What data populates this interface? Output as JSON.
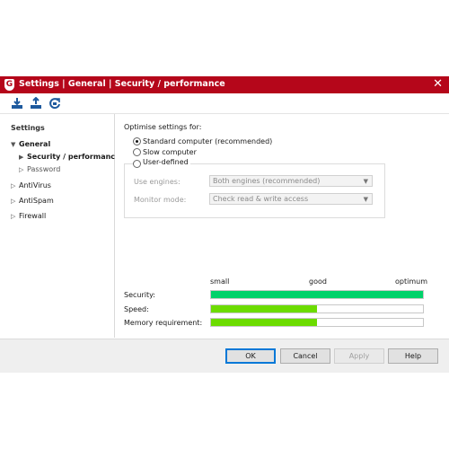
{
  "window": {
    "title": "Settings | General | Security / performance",
    "logo_letter": "G",
    "close_glyph": "✕",
    "accent_color": "#b5061a"
  },
  "toolbar": {
    "icons": [
      "import-icon",
      "export-icon",
      "restore-defaults-icon"
    ]
  },
  "sidebar": {
    "heading": "Settings",
    "items": [
      {
        "label": "General",
        "expanded": true
      },
      {
        "label": "Security / performance",
        "selected": true
      },
      {
        "label": "Password"
      },
      {
        "label": "AntiVirus"
      },
      {
        "label": "AntiSpam"
      },
      {
        "label": "Firewall"
      }
    ]
  },
  "main": {
    "optimise_label": "Optimise settings for:",
    "options": [
      {
        "label": "Standard computer (recommended)",
        "checked": true
      },
      {
        "label": "Slow computer",
        "checked": false
      },
      {
        "label": "User-defined",
        "checked": false
      }
    ],
    "use_engines_label": "Use engines:",
    "use_engines_value": "Both engines (recommended)",
    "monitor_mode_label": "Monitor mode:",
    "monitor_mode_value": "Check read & write access",
    "scale": {
      "low": "small",
      "mid": "good",
      "high": "optimum"
    },
    "meters": [
      {
        "label": "Security:",
        "fraction": 1.0,
        "color": "#00d26a"
      },
      {
        "label": "Speed:",
        "fraction": 0.5,
        "color": "#6cdc00"
      },
      {
        "label": "Memory requirement:",
        "fraction": 0.5,
        "color": "#6cdc00"
      }
    ]
  },
  "buttons": {
    "ok": "OK",
    "cancel": "Cancel",
    "apply": "Apply",
    "help": "Help"
  }
}
